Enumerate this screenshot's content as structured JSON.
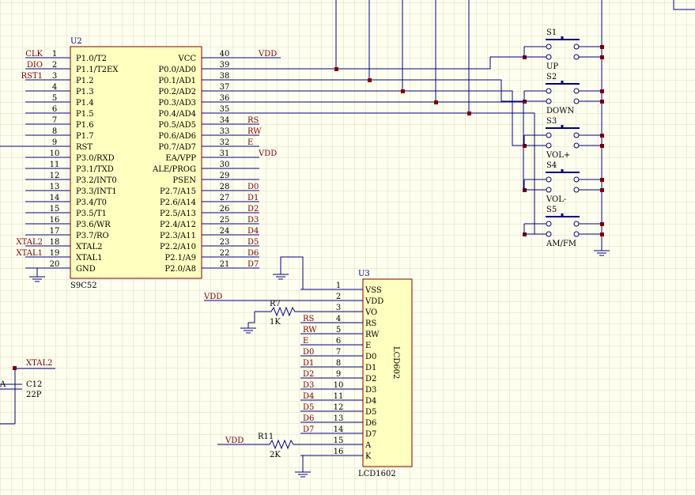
{
  "u2": {
    "ref": "U2",
    "part": "S9C52",
    "left_pins": [
      {
        "num": "1",
        "name": "P1.0/T2",
        "net": "CLK"
      },
      {
        "num": "2",
        "name": "P1.1/T2EX",
        "net": "DIO"
      },
      {
        "num": "3",
        "name": "P1.2",
        "net": "RST1"
      },
      {
        "num": "4",
        "name": "P1.3",
        "net": ""
      },
      {
        "num": "5",
        "name": "P1.4",
        "net": ""
      },
      {
        "num": "6",
        "name": "P1.5",
        "net": ""
      },
      {
        "num": "7",
        "name": "P1.6",
        "net": ""
      },
      {
        "num": "8",
        "name": "P1.7",
        "net": ""
      },
      {
        "num": "9",
        "name": "RST",
        "net": ""
      },
      {
        "num": "10",
        "name": "P3.0/RXD",
        "net": ""
      },
      {
        "num": "11",
        "name": "P3.1/TXD",
        "net": ""
      },
      {
        "num": "12",
        "name": "P3.2/INT0",
        "net": ""
      },
      {
        "num": "13",
        "name": "P3.3/INT1",
        "net": ""
      },
      {
        "num": "14",
        "name": "P3.4/T0",
        "net": ""
      },
      {
        "num": "15",
        "name": "P3.5/T1",
        "net": ""
      },
      {
        "num": "16",
        "name": "P3.6/WR",
        "net": ""
      },
      {
        "num": "17",
        "name": "P3.7/RO",
        "net": ""
      },
      {
        "num": "18",
        "name": "XTAL2",
        "net": "XTAL2"
      },
      {
        "num": "19",
        "name": "XTAL1",
        "net": "XTAL1"
      },
      {
        "num": "20",
        "name": "GND",
        "net": ""
      }
    ],
    "right_pins": [
      {
        "num": "40",
        "name": "VCC",
        "net": "VDD"
      },
      {
        "num": "39",
        "name": "P0.0/AD0",
        "net": ""
      },
      {
        "num": "38",
        "name": "P0.1/AD1",
        "net": ""
      },
      {
        "num": "37",
        "name": "P0.2/AD2",
        "net": ""
      },
      {
        "num": "36",
        "name": "P0.3/AD3",
        "net": ""
      },
      {
        "num": "35",
        "name": "P0.4/AD4",
        "net": ""
      },
      {
        "num": "34",
        "name": "P0.5/AD5",
        "net": "RS"
      },
      {
        "num": "33",
        "name": "P0.6/AD6",
        "net": "RW"
      },
      {
        "num": "32",
        "name": "P0.7/AD7",
        "net": "E"
      },
      {
        "num": "31",
        "name": "EA/VPP",
        "net": "VDD"
      },
      {
        "num": "30",
        "name": "ALE/PROG",
        "net": ""
      },
      {
        "num": "29",
        "name": "PSEN",
        "net": ""
      },
      {
        "num": "28",
        "name": "P2.7/A15",
        "net": "D0"
      },
      {
        "num": "27",
        "name": "P2.6/A14",
        "net": "D1"
      },
      {
        "num": "26",
        "name": "P2.5/A13",
        "net": "D2"
      },
      {
        "num": "25",
        "name": "P2.4/A12",
        "net": "D3"
      },
      {
        "num": "24",
        "name": "P2.3/A11",
        "net": "D4"
      },
      {
        "num": "23",
        "name": "P2.2/A10",
        "net": "D5"
      },
      {
        "num": "22",
        "name": "P2.1/A9",
        "net": "D6"
      },
      {
        "num": "21",
        "name": "P2.0/A8",
        "net": "D7"
      }
    ]
  },
  "u3": {
    "ref": "U3",
    "part": "LCD1602",
    "body_label": "LCD602",
    "pins": [
      {
        "num": "1",
        "name": "VSS",
        "net": ""
      },
      {
        "num": "2",
        "name": "VDD",
        "net": ""
      },
      {
        "num": "3",
        "name": "VO",
        "net": ""
      },
      {
        "num": "4",
        "name": "RS",
        "net": "RS"
      },
      {
        "num": "5",
        "name": "RW",
        "net": "RW"
      },
      {
        "num": "6",
        "name": "E",
        "net": "E"
      },
      {
        "num": "7",
        "name": "D0",
        "net": "D0"
      },
      {
        "num": "8",
        "name": "D1",
        "net": "D1"
      },
      {
        "num": "9",
        "name": "D2",
        "net": "D2"
      },
      {
        "num": "10",
        "name": "D3",
        "net": "D3"
      },
      {
        "num": "11",
        "name": "D4",
        "net": "D4"
      },
      {
        "num": "12",
        "name": "D5",
        "net": "D5"
      },
      {
        "num": "13",
        "name": "D6",
        "net": "D6"
      },
      {
        "num": "14",
        "name": "D7",
        "net": "D7"
      },
      {
        "num": "15",
        "name": "A",
        "net": ""
      },
      {
        "num": "16",
        "name": "K",
        "net": ""
      }
    ]
  },
  "switches": [
    {
      "ref": "S1",
      "label": "UP"
    },
    {
      "ref": "S2",
      "label": "DOWN"
    },
    {
      "ref": "S3",
      "label": "VOL+"
    },
    {
      "ref": "S4",
      "label": "VOL-"
    },
    {
      "ref": "S5",
      "label": "AM/FM"
    }
  ],
  "resistors": [
    {
      "ref": "R7",
      "value": "1K"
    },
    {
      "ref": "R11",
      "value": "2K"
    }
  ],
  "vdd_labels": {
    "lcd_vdd": "VDD",
    "backlight_vdd": "VDD"
  },
  "capacitor": {
    "ref": "C12",
    "value": "22P",
    "net": "XTAL2",
    "partial": "A"
  }
}
